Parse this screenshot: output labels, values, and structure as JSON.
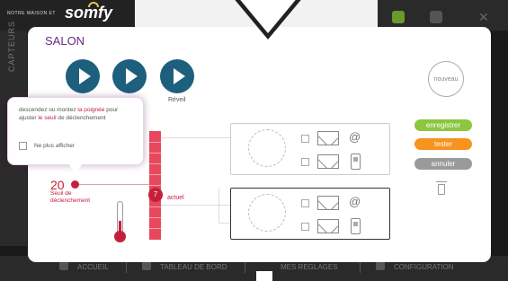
{
  "background_app": {
    "brand_small": "NOTRE MAISON ET",
    "logo": "somfy",
    "side_label": "CAPTEURS",
    "nav": [
      {
        "label": "ACCUEIL"
      },
      {
        "label": "TABLEAU DE BORD"
      },
      {
        "label": "MES REGLAGES"
      },
      {
        "label": "CONFIGURATION"
      }
    ]
  },
  "modal": {
    "title": "SALON",
    "scenarios": [
      {
        "label": ""
      },
      {
        "label": ""
      },
      {
        "label": "Réveil"
      }
    ],
    "new_button": "nouveau",
    "actions": {
      "save": "enregistrer",
      "test": "tester",
      "cancel": "annuler"
    },
    "tooltip": {
      "text_1": "descendez ou montez ",
      "text_highlight_1": "la poignée",
      "text_2": " pour ajuster ",
      "text_highlight_2": "le seuil",
      "text_3": " de déclenchement",
      "checkbox_label": "Ne plus afficher"
    },
    "threshold": {
      "value": "20",
      "label_line1": "Seuil de",
      "label_line2": "déclenchement"
    },
    "current": {
      "value": "7",
      "label": "actuel"
    },
    "blocks": [
      {
        "at_symbol": "@"
      },
      {
        "at_symbol": "@"
      }
    ]
  },
  "colors": {
    "accent_purple": "#6b2a87",
    "play_blue": "#1d5f7d",
    "save_green": "#8cc63f",
    "test_orange": "#f7941d",
    "cancel_gray": "#9a9a9a",
    "threshold_red": "#c4203a"
  }
}
